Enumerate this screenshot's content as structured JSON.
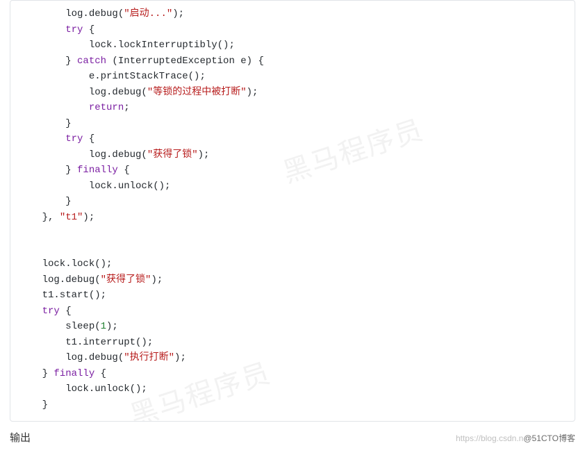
{
  "code": {
    "indent": "    ",
    "strings": {
      "startup": "\"启动...\"",
      "interrupted": "\"等锁的过程中被打断\"",
      "gotlock": "\"获得了锁\"",
      "dointerrupt": "\"执行打断\"",
      "threadname": "\"t1\""
    },
    "lines": {
      "l1a": "        log.debug(",
      "l1b": ");",
      "l2a": "        ",
      "l2_try": "try",
      "l2b": " {",
      "l3": "            lock.lockInterruptibly();",
      "l4a": "        } ",
      "l4_catch": "catch",
      "l4b": " (InterruptedException e) {",
      "l5": "            e.printStackTrace();",
      "l6a": "            log.debug(",
      "l6b": ");",
      "l7a": "            ",
      "l7_return": "return",
      "l7b": ";",
      "l8": "        }",
      "l9a": "        ",
      "l9_try": "try",
      "l9b": " {",
      "l10a": "            log.debug(",
      "l10b": ");",
      "l11a": "        } ",
      "l11_finally": "finally",
      "l11b": " {",
      "l12": "            lock.unlock();",
      "l13": "        }",
      "l14a": "    }, ",
      "l14b": ");",
      "blank": "",
      "l17": "    lock.lock();",
      "l18a": "    log.debug(",
      "l18b": ");",
      "l19": "    t1.start();",
      "l20a": "    ",
      "l20_try": "try",
      "l20b": " {",
      "l21a": "        sleep(",
      "l21_num": "1",
      "l21b": ");",
      "l22": "        t1.interrupt();",
      "l23a": "        log.debug(",
      "l23b": ");",
      "l24a": "    } ",
      "l24_finally": "finally",
      "l24b": " {",
      "l25": "        lock.unlock();",
      "l26": "    }"
    }
  },
  "footer": {
    "output_label": "输出",
    "attribution_faint": "https://blog.csdn.n",
    "attribution_dark": "@51CTO博客"
  },
  "watermark": "黑马程序员"
}
